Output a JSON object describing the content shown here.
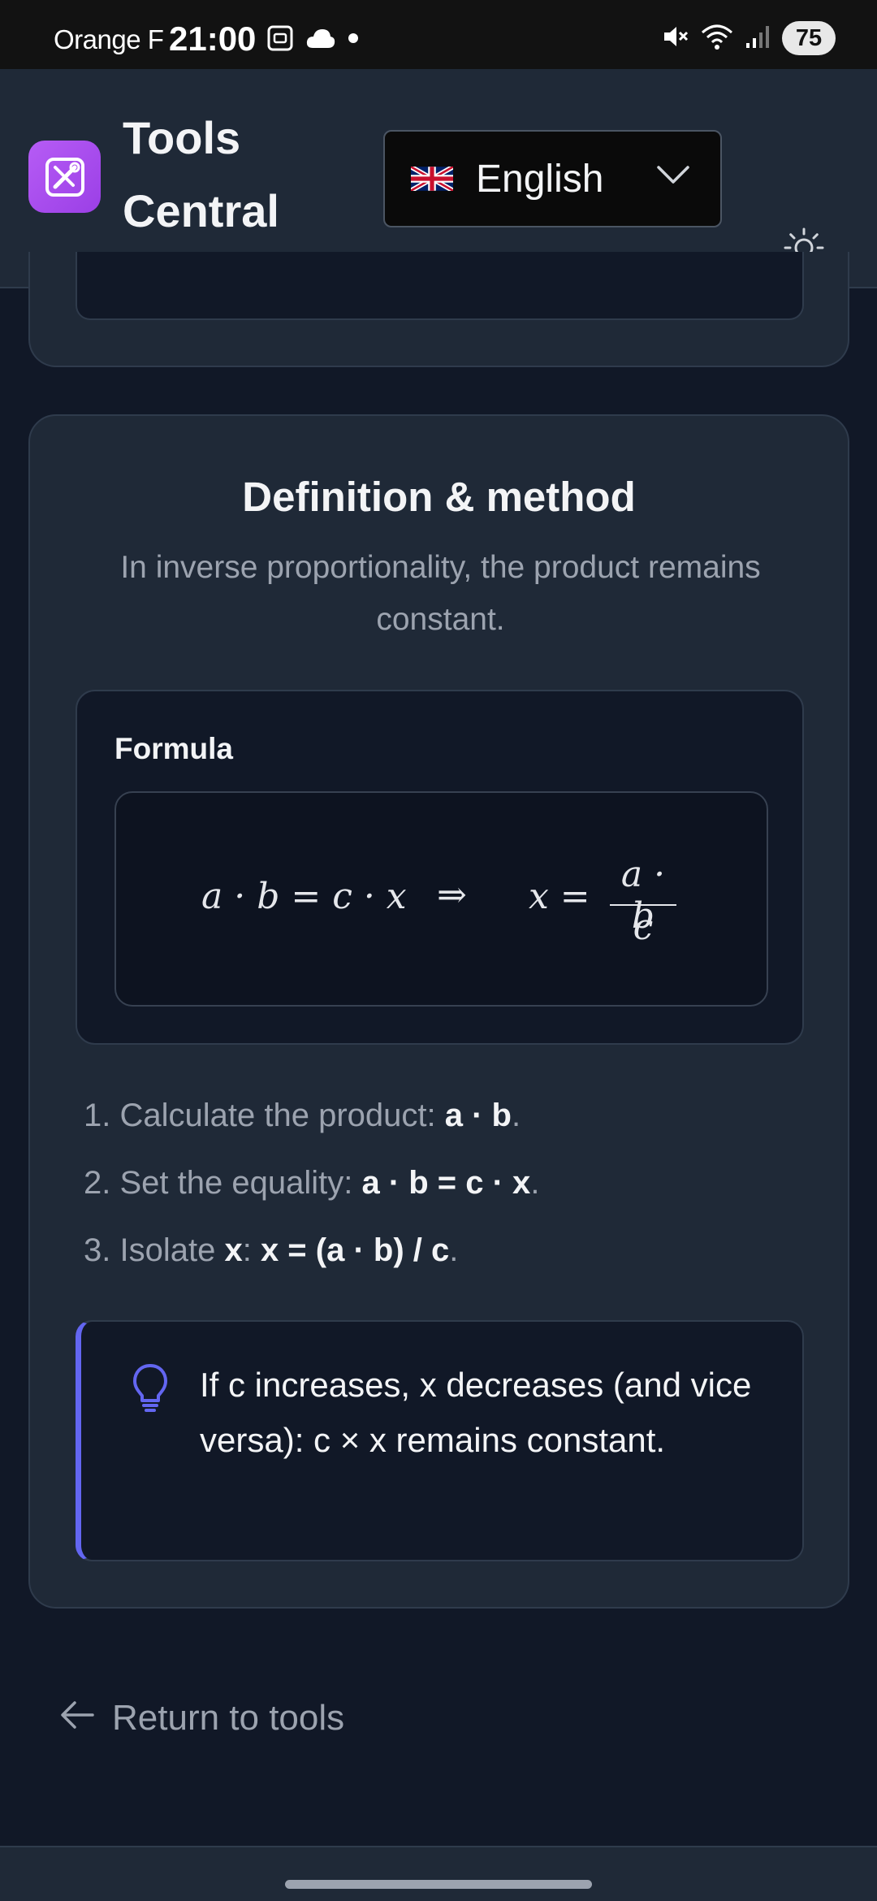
{
  "status_bar": {
    "carrier": "Orange F",
    "time": "21:00",
    "battery": "75",
    "icons_left": [
      "screenshot-icon",
      "cloud-icon",
      "dot-icon"
    ],
    "icons_right": [
      "mute-icon",
      "wifi-icon",
      "signal-icon"
    ]
  },
  "header": {
    "brand_line1": "Tools",
    "brand_line2": "Central",
    "logo_icon": "tools-icon",
    "language": "English",
    "language_flag_icon": "uk-flag-icon",
    "theme_icon": "sun-icon"
  },
  "definition": {
    "title": "Definition & method",
    "subtitle": "In inverse proportionality, the product remains constant.",
    "formula_label": "Formula",
    "formula": {
      "lhs": "a · b = c · x",
      "implies": "⇒",
      "rhs_prefix": "x =",
      "numerator": "a · b",
      "denominator": "c"
    },
    "steps": [
      {
        "num": "1.",
        "text": "Calculate the product: ",
        "bold": "a · b",
        "end": "."
      },
      {
        "num": "2.",
        "text": "Set the equality: ",
        "bold": "a · b = c · x",
        "end": "."
      },
      {
        "num": "3.",
        "text": "Isolate ",
        "bold1": "x",
        "mid": ": ",
        "bold2": "x = (a · b) / c",
        "end": "."
      }
    ],
    "tip": "If c increases, x decreases (and vice versa): c × x remains constant.",
    "tip_icon": "lightbulb-icon"
  },
  "footer": {
    "back_label": "Return to tools",
    "back_icon": "arrow-left-icon"
  },
  "colors": {
    "background": "#111827",
    "card": "#1f2937",
    "accent": "#6366f1",
    "logo": "#a855f7"
  }
}
